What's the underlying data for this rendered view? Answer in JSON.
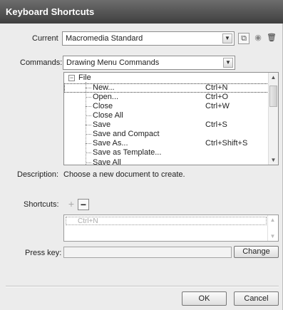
{
  "window": {
    "title": "Keyboard Shortcuts"
  },
  "current": {
    "label": "Current",
    "value": "Macromedia Standard",
    "icons": [
      "duplicate-set-icon",
      "rename-set-icon",
      "delete-set-icon"
    ]
  },
  "commands": {
    "label": "Commands:",
    "value": "Drawing Menu Commands"
  },
  "tree": {
    "group": "File",
    "items": [
      {
        "name": "New...",
        "shortcut": "Ctrl+N"
      },
      {
        "name": "Open...",
        "shortcut": "Ctrl+O"
      },
      {
        "name": "Close",
        "shortcut": "Ctrl+W"
      },
      {
        "name": "Close All",
        "shortcut": ""
      },
      {
        "name": "Save",
        "shortcut": "Ctrl+S"
      },
      {
        "name": "Save and Compact",
        "shortcut": ""
      },
      {
        "name": "Save As...",
        "shortcut": "Ctrl+Shift+S"
      },
      {
        "name": "Save as Template...",
        "shortcut": ""
      },
      {
        "name": "Save All",
        "shortcut": ""
      }
    ]
  },
  "description": {
    "label": "Description:",
    "text": "Choose a new document to create."
  },
  "shortcuts": {
    "label": "Shortcuts:",
    "add": "+",
    "remove": "−",
    "entry": "Ctrl+N"
  },
  "presskey": {
    "label": "Press key:",
    "value": "",
    "change": "Change"
  },
  "footer": {
    "ok": "OK",
    "cancel": "Cancel"
  }
}
